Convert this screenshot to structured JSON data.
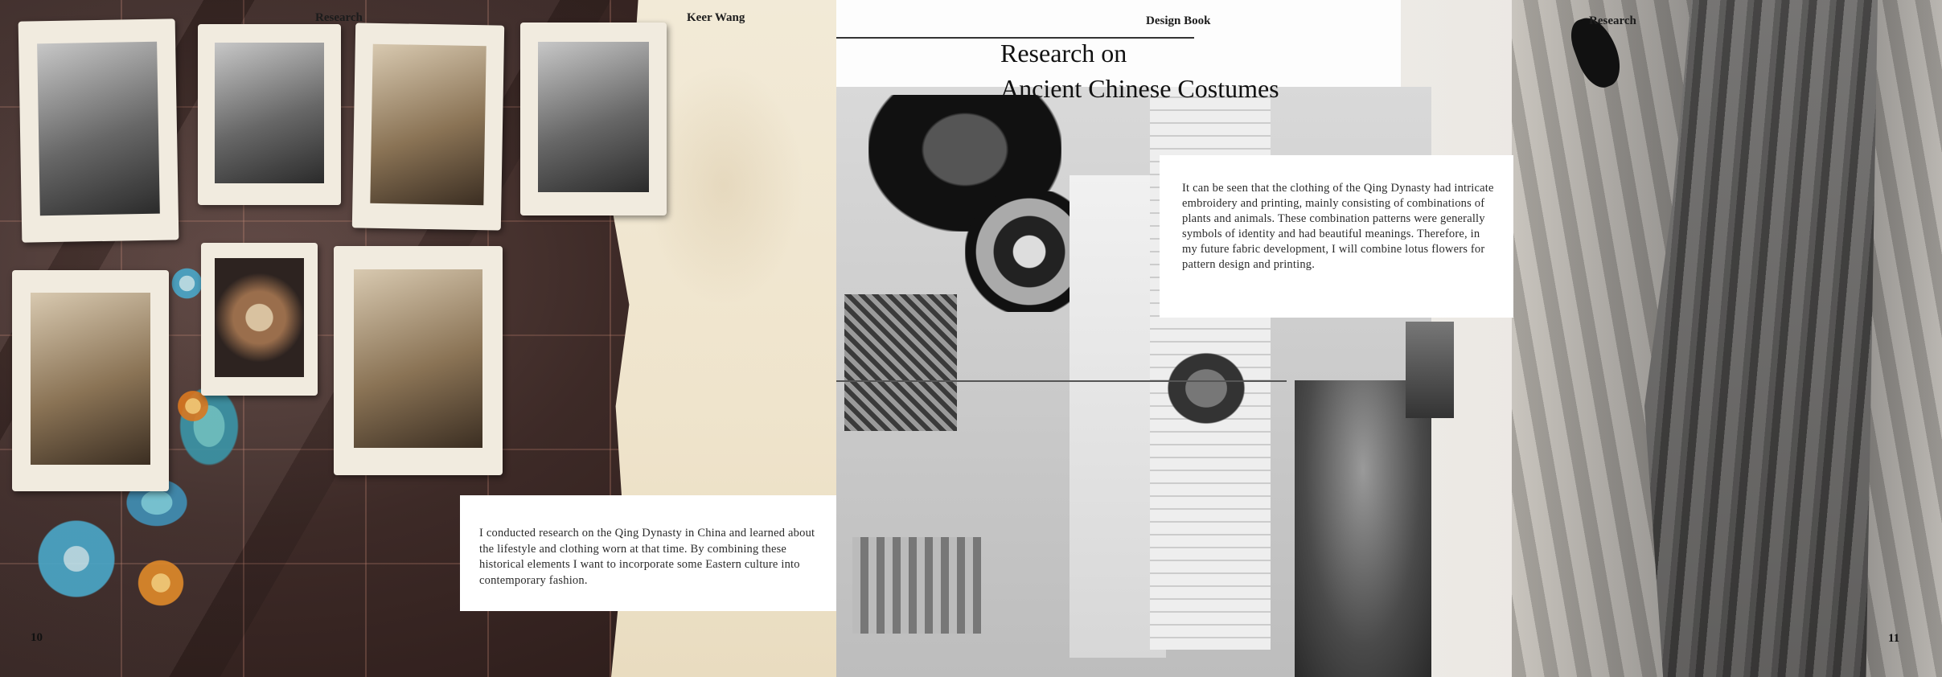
{
  "left_page": {
    "header_section": "Research",
    "header_author": "Keer Wang",
    "page_number": "10",
    "body_text": "I conducted research on the Qing Dynasty in China and learned about the lifestyle and clothing worn at that time.  By combining these historical elements I want to incorporate some Eastern culture into contemporary fashion."
  },
  "right_page": {
    "header_book": "Design Book",
    "header_section": "Research",
    "page_number": "11",
    "title_line1": "Research on",
    "title_line2": "Ancient Chinese Costumes",
    "body_text": "It can be seen that the clothing of the Qing Dynasty had intricate embroidery and printing, mainly consisting of combinations of plants and animals. These combination patterns were generally symbols of identity and had beautiful meanings. Therefore, in my future fabric development, I will combine lotus flowers for pattern design and printing."
  },
  "colors": {
    "fabric": "#3d2a27",
    "paper": "#efe4cc",
    "text": "#2a2a2a",
    "embroidery_blue": "#4aa8c9",
    "embroidery_orange": "#e08a2a"
  }
}
